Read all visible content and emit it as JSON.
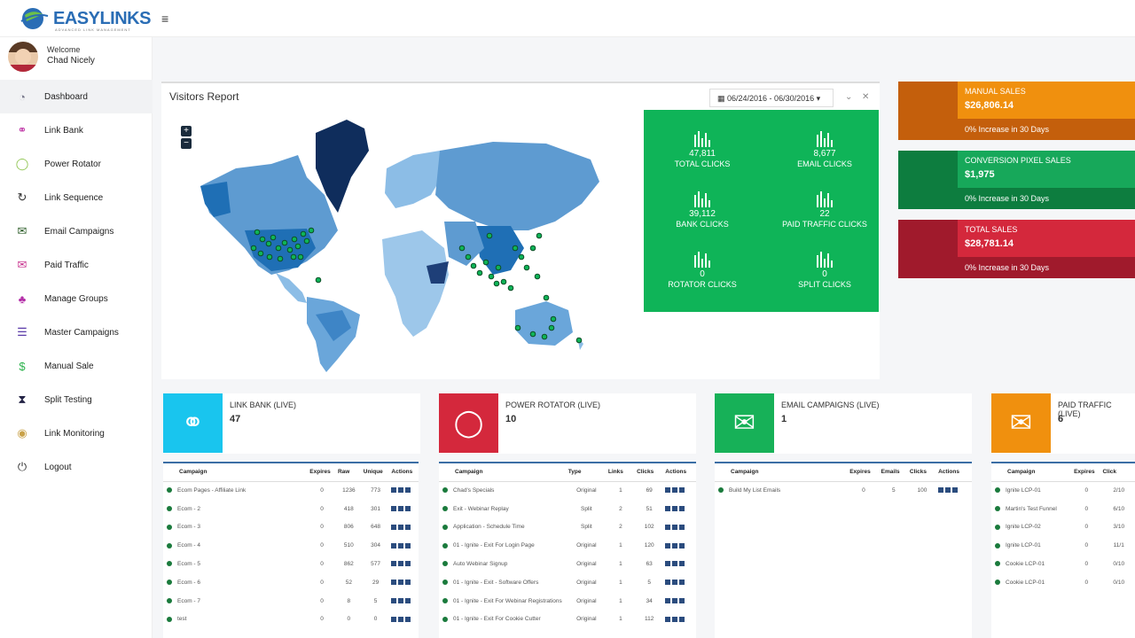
{
  "app": {
    "logo_text": "EASYLINKS",
    "logo_subtitle": "ADVANCED LINK MANAGEMENT"
  },
  "user": {
    "welcome": "Welcome",
    "name": "Chad Nicely"
  },
  "nav": [
    {
      "label": "Dashboard",
      "icon": "dashboard-icon",
      "color": "#7a7a8c"
    },
    {
      "label": "Link Bank",
      "icon": "link-icon",
      "color": "#c03aa8"
    },
    {
      "label": "Power Rotator",
      "icon": "circle-notch-icon",
      "color": "#8bc34a"
    },
    {
      "label": "Link Sequence",
      "icon": "refresh-icon",
      "color": "#333333"
    },
    {
      "label": "Email Campaigns",
      "icon": "envelope-icon",
      "color": "#2e5e2a"
    },
    {
      "label": "Paid Traffic",
      "icon": "envelope-outline-icon",
      "color": "#c8328e"
    },
    {
      "label": "Manage Groups",
      "icon": "users-icon",
      "color": "#b42fa8"
    },
    {
      "label": "Master Campaigns",
      "icon": "list-icon",
      "color": "#5a3aa8"
    },
    {
      "label": "Manual Sale",
      "icon": "dollar-icon",
      "color": "#2bb24c"
    },
    {
      "label": "Split Testing",
      "icon": "hourglass-icon",
      "color": "#222244"
    },
    {
      "label": "Link Monitoring",
      "icon": "globe-icon",
      "color": "#c9a24a"
    },
    {
      "label": "Logout",
      "icon": "power-icon",
      "color": "#333333"
    }
  ],
  "visitors": {
    "title": "Visitors Report",
    "date_range": "06/24/2016 - 06/30/2016",
    "zoom_in": "+",
    "zoom_out": "−"
  },
  "stats": [
    {
      "value": "47,811",
      "label": "TOTAL CLICKS"
    },
    {
      "value": "8,677",
      "label": "EMAIL CLICKS"
    },
    {
      "value": "39,112",
      "label": "BANK CLICKS"
    },
    {
      "value": "22",
      "label": "PAID TRAFFIC CLICKS"
    },
    {
      "value": "0",
      "label": "ROTATOR CLICKS"
    },
    {
      "value": "0",
      "label": "SPLIT CLICKS"
    }
  ],
  "sales": [
    {
      "title": "MANUAL SALES",
      "value": "$26,806.14",
      "footer": "0% Increase in 30 Days",
      "color": "#f0900e",
      "dark": "#c45f0c"
    },
    {
      "title": "CONVERSION PIXEL SALES",
      "value": "$1,975",
      "footer": "0% Increase in 30 Days",
      "color": "#17a85a",
      "dark": "#0d7d3f"
    },
    {
      "title": "TOTAL SALES",
      "value": "$28,781.14",
      "footer": "0% Increase in 30 Days",
      "color": "#d4283c",
      "dark": "#a01a2c"
    }
  ],
  "boxes": [
    {
      "title": "LINK BANK (LIVE)",
      "count": "47",
      "color": "#19c5ee",
      "icon": "link-icon"
    },
    {
      "title": "POWER ROTATOR (LIVE)",
      "count": "10",
      "color": "#d4283c",
      "icon": "circle-notch-icon"
    },
    {
      "title": "EMAIL CAMPAIGNS (LIVE)",
      "count": "1",
      "color": "#17b158",
      "icon": "envelope-icon"
    },
    {
      "title": "PAID TRAFFIC (LIVE)",
      "count": "6",
      "color": "#f0900e",
      "icon": "envelope-outline-icon"
    }
  ],
  "tables": [
    {
      "headers": [
        "Campaign",
        "Expires",
        "Raw",
        "Unique",
        "Actions"
      ],
      "rows": [
        [
          "Ecom Pages - Affiliate Link",
          "0",
          "1236",
          "773"
        ],
        [
          "Ecom - 2",
          "0",
          "418",
          "301"
        ],
        [
          "Ecom - 3",
          "0",
          "806",
          "648"
        ],
        [
          "Ecom - 4",
          "0",
          "510",
          "304"
        ],
        [
          "Ecom - 5",
          "0",
          "862",
          "577"
        ],
        [
          "Ecom - 6",
          "0",
          "52",
          "29"
        ],
        [
          "Ecom - 7",
          "0",
          "8",
          "5"
        ],
        [
          "test",
          "0",
          "0",
          "0"
        ]
      ]
    },
    {
      "headers": [
        "Campaign",
        "Type",
        "Links",
        "Clicks",
        "Actions"
      ],
      "rows": [
        [
          "Chad's Specials",
          "Original",
          "1",
          "69"
        ],
        [
          "Exit - Webinar Replay",
          "Split",
          "2",
          "51"
        ],
        [
          "Application - Schedule Time",
          "Split",
          "2",
          "102"
        ],
        [
          "01 - Ignite - Exit For Login Page",
          "Original",
          "1",
          "120"
        ],
        [
          "Auto Webinar Signup",
          "Original",
          "1",
          "63"
        ],
        [
          "01 - Ignite - Exit - Software Offers",
          "Original",
          "1",
          "5"
        ],
        [
          "01 - Ignite - Exit For Webinar Registrations",
          "Original",
          "1",
          "34"
        ],
        [
          "01 - Ignite - Exit For Cookie Cutter",
          "Original",
          "1",
          "112"
        ]
      ]
    },
    {
      "headers": [
        "Campaign",
        "Expires",
        "Emails",
        "Clicks",
        "Actions"
      ],
      "rows": [
        [
          "Build My List Emails",
          "0",
          "5",
          "100"
        ]
      ]
    },
    {
      "headers": [
        "Campaign",
        "Expires",
        "Click"
      ],
      "rows": [
        [
          "Ignite LCP-01",
          "0",
          "2/10"
        ],
        [
          "Martin's Test Funnel",
          "0",
          "6/10"
        ],
        [
          "Ignite LCP-02",
          "0",
          "3/10"
        ],
        [
          "Ignite LCP-01",
          "0",
          "11/1"
        ],
        [
          "Cookie LCP-01",
          "0",
          "0/10"
        ],
        [
          "Cookie LCP-01",
          "0",
          "0/10"
        ]
      ]
    }
  ]
}
